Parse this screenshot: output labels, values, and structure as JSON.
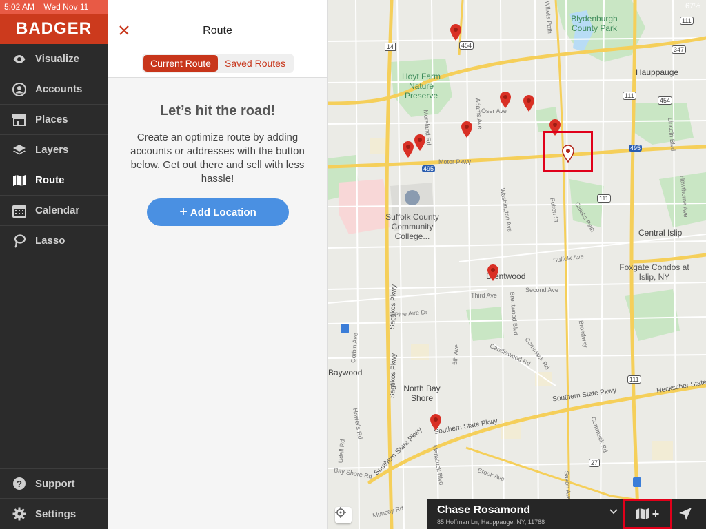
{
  "status": {
    "time": "5:02 AM",
    "date": "Wed Nov 11",
    "battery": "67%"
  },
  "brand": {
    "name": "BADGER",
    "color": "#cc3a1d"
  },
  "sidebar": {
    "items": [
      {
        "label": "Visualize",
        "icon": "eye-icon"
      },
      {
        "label": "Accounts",
        "icon": "person-icon"
      },
      {
        "label": "Places",
        "icon": "storefront-icon"
      },
      {
        "label": "Layers",
        "icon": "layers-icon"
      },
      {
        "label": "Route",
        "icon": "map-icon",
        "active": true
      },
      {
        "label": "Calendar",
        "icon": "calendar-icon"
      },
      {
        "label": "Lasso",
        "icon": "lasso-icon"
      }
    ],
    "bottom": [
      {
        "label": "Support",
        "icon": "help-icon"
      },
      {
        "label": "Settings",
        "icon": "gear-icon"
      }
    ]
  },
  "route": {
    "title": "Route",
    "tabs": [
      "Current Route",
      "Saved Routes"
    ],
    "active_tab": "Current Route",
    "empty_title": "Let’s hit the road!",
    "empty_body": "Create an optimize route by adding accounts or addresses with the button below. Get out there and sell with less hassle!",
    "add_button": "Add Location",
    "accent": "#c8361b",
    "button_color": "#4a90e2"
  },
  "map": {
    "labels": {
      "blydenburgh": "Blydenburgh County Park",
      "hauppauge": "Hauppauge",
      "hoyt": "Hoyt Farm Nature Preserve",
      "suffolk": "Suffolk County Community College...",
      "central_islip": "Central Islip",
      "foxgate": "Foxgate Condos at Islip, NY",
      "brentwood": "Brentwood",
      "baywood": "Baywood",
      "north_bay_shore": "North Bay Shore",
      "sagtikos": "Sagtikos Pkwy",
      "sagtikos2": "Sagtikos Pkwy",
      "southern_state": "Southern State Pkwy",
      "southern_state2": "Southern State Pkwy",
      "southern_state3": "Southern State Pkwy",
      "heckscher": "Heckscher State",
      "motor_pkwy": "Motor Pkwy",
      "oser": "Oser Ave",
      "suffolk_ave": "Suffolk Ave",
      "third_ave": "Third Ave",
      "second_ave": "Second Ave",
      "pine_aire": "Pine Aire Dr",
      "candlewood": "Candlewood Rd",
      "commack_rd": "Commack Rd",
      "broadway": "Broadway",
      "brook_ave": "Brook Ave",
      "muncey": "Muncey Rd",
      "bay_shore_rd": "Bay Shore Rd",
      "fulton": "Fulton St",
      "calebs": "Calebs Path",
      "washington": "Washington Ave",
      "brentwood_blvd": "Brentwood Blvd",
      "fifth_ave": "5th Ave",
      "corbin": "Corbin Ave",
      "howells": "Howells Rd",
      "udall": "Udall Rd",
      "manatuck": "Manatuck Blvd",
      "saxon": "Saxon Ave",
      "lincoln": "Lincoln Blvd",
      "hawthorne": "Hawthorne Ave",
      "commack_rd2": "Commack Rd",
      "adams": "Adams Ave",
      "moreland": "Moreland Rd",
      "willets": "Willets Path"
    },
    "shields": {
      "r454a": "454",
      "r454b": "454",
      "r14": "14",
      "r111a": "111",
      "r111b": "111",
      "r111c": "111",
      "r111d": "111",
      "r347": "347",
      "r495a": "495",
      "r495b": "495",
      "r27": "27"
    },
    "pin_color": "#d93025"
  },
  "account": {
    "name": "Chase Rosamond",
    "address": "85 Hoffman Ln, Hauppauge, NY, 11788"
  }
}
